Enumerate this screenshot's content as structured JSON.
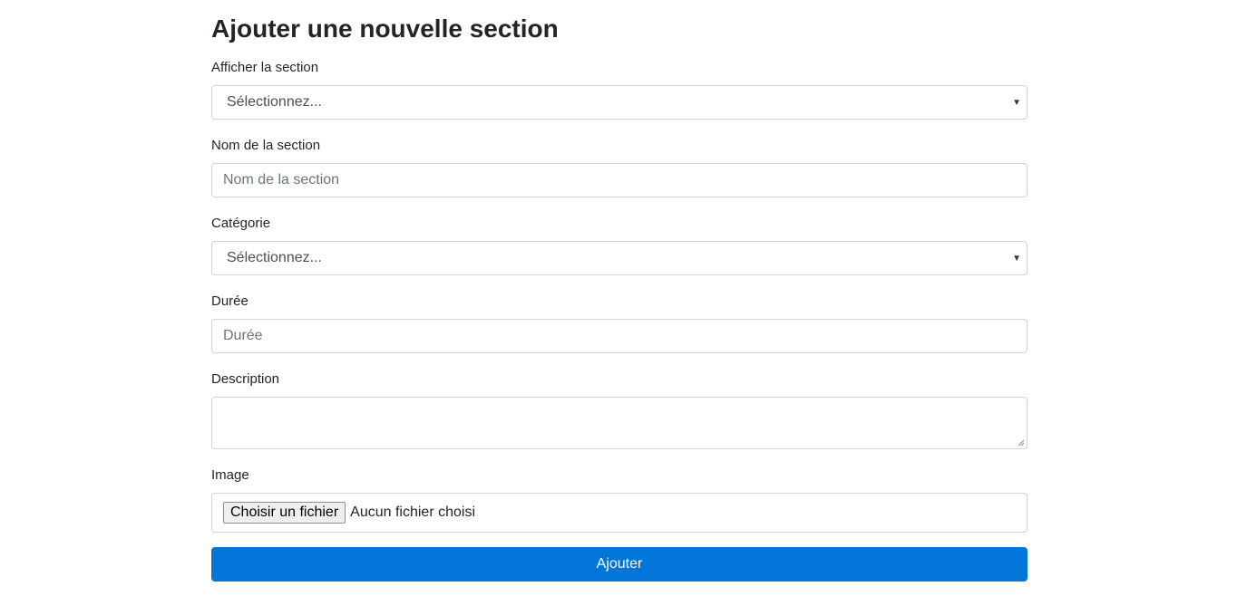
{
  "page": {
    "title": "Ajouter une nouvelle section"
  },
  "form": {
    "show_section": {
      "label": "Afficher la section",
      "selected": "Sélectionnez..."
    },
    "section_name": {
      "label": "Nom de la section",
      "placeholder": "Nom de la section",
      "value": ""
    },
    "category": {
      "label": "Catégorie",
      "selected": "Sélectionnez..."
    },
    "duration": {
      "label": "Durée",
      "placeholder": "Durée",
      "value": ""
    },
    "description": {
      "label": "Description",
      "value": ""
    },
    "image": {
      "label": "Image",
      "button_label": "Choisir un fichier",
      "status": "Aucun fichier choisi"
    },
    "submit_label": "Ajouter"
  },
  "icons": {
    "dropdown": "chevron-down-icon",
    "resize": "resize-handle-icon"
  },
  "colors": {
    "accent": "#0275d8",
    "border": "#ced4da",
    "text": "#212529",
    "placeholder": "#6c757d"
  }
}
